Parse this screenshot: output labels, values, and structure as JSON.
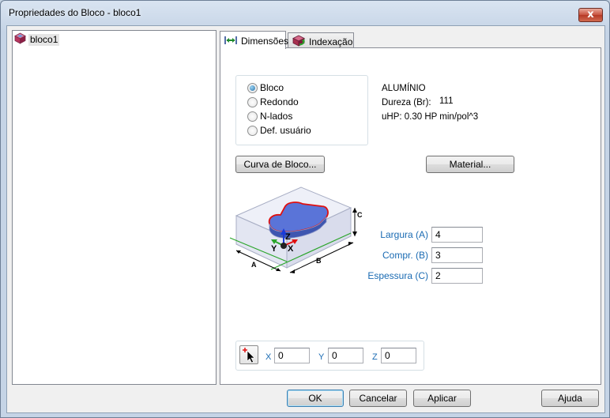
{
  "window": {
    "title": "Propriedades do Bloco - bloco1",
    "close_glyph": "x"
  },
  "tree": {
    "items": [
      {
        "label": "bloco1",
        "icon": "block-icon"
      }
    ]
  },
  "tabs": [
    {
      "label": "Dimensões",
      "icon": "dimension-arrows-icon",
      "active": true
    },
    {
      "label": "Indexação",
      "icon": "indexing-icon",
      "active": false
    }
  ],
  "shape": {
    "options": [
      "Bloco",
      "Redondo",
      "N-lados",
      "Def. usuário"
    ],
    "selected": "Bloco"
  },
  "material": {
    "name": "ALUMÍNIO",
    "hardness_label": "Dureza (Br):",
    "hardness_value": "111",
    "uhp": "uHP: 0.30 HP min/pol^3"
  },
  "buttons": {
    "block_curve": "Curva de Bloco...",
    "material": "Material...",
    "ok": "OK",
    "cancel": "Cancelar",
    "apply": "Aplicar",
    "help": "Ajuda"
  },
  "dimensions": {
    "width_label": "Largura (A)",
    "width_value": "4",
    "length_label": "Compr. (B)",
    "length_value": "3",
    "thickness_label": "Espessura (C)",
    "thickness_value": "2"
  },
  "diagram": {
    "label_a": "A",
    "label_b": "B",
    "label_c": "C",
    "axis_x": "X",
    "axis_y": "Y",
    "axis_z": "Z"
  },
  "origin": {
    "x_label": "X",
    "x_value": "0",
    "y_label": "Y",
    "y_value": "0",
    "z_label": "Z",
    "z_value": "0",
    "pick_icon": "pick-point-cursor-icon"
  },
  "colors": {
    "label_blue": "#1a6bb3",
    "stock_outline_red": "#e01010",
    "stock_fill_blue": "#5a74d8",
    "axis_green": "#2aa52a"
  }
}
